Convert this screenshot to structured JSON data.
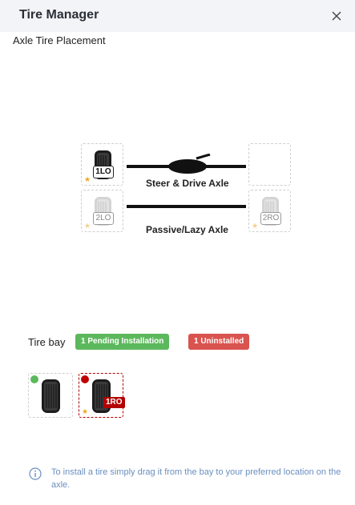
{
  "header": {
    "title": "Tire Manager"
  },
  "section": {
    "label": "Axle Tire Placement"
  },
  "axles": [
    {
      "name": "Steer & Drive Axle",
      "left_slot": {
        "position": "1LO",
        "filled": true
      },
      "right_slot": {
        "position": "",
        "filled": false
      }
    },
    {
      "name": "Passive/Lazy Axle",
      "left_slot": {
        "position": "2LO",
        "filled": false
      },
      "right_slot": {
        "position": "2RO",
        "filled": false
      }
    }
  ],
  "tire_bay": {
    "label": "Tire bay",
    "pending_badge": "1 Pending Installation",
    "uninstalled_badge": "1 Uninstalled",
    "items": [
      {
        "status": "pending",
        "status_color": "#5cb85c",
        "position": ""
      },
      {
        "status": "uninstalled",
        "status_color": "#c00000",
        "position": "1RO"
      }
    ]
  },
  "info": {
    "text": "To install a tire simply drag it from the bay to your preferred location on the axle."
  },
  "icons": [
    "close-icon",
    "tire-icon",
    "star-icon",
    "differential-icon",
    "info-icon"
  ],
  "colors": {
    "accent_green": "#5cb85c",
    "accent_red": "#d9534f",
    "info_blue": "#6a8fc0",
    "star": "#f3a51c"
  }
}
